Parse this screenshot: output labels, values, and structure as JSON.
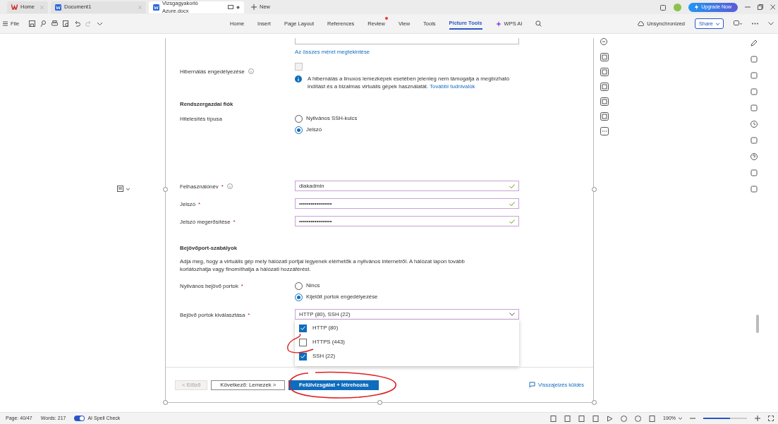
{
  "tabs": [
    {
      "label": "Home",
      "kind": "home",
      "selected": false
    },
    {
      "label": "Document1",
      "kind": "doc",
      "selected": false
    },
    {
      "label": "Vizsgagyakorló Azure.docx",
      "kind": "doc",
      "selected": true
    }
  ],
  "new_tab": "New",
  "upgrade": "Upgrade Now",
  "file_menu": "File",
  "ribbon": [
    {
      "label": "Home",
      "selected": false
    },
    {
      "label": "Insert",
      "selected": false
    },
    {
      "label": "Page Layout",
      "selected": false
    },
    {
      "label": "References",
      "selected": false
    },
    {
      "label": "Review",
      "selected": false,
      "dot": true
    },
    {
      "label": "View",
      "selected": false
    },
    {
      "label": "Tools",
      "selected": false
    },
    {
      "label": "Picture Tools",
      "selected": true
    },
    {
      "label": "WPS AI",
      "selected": false,
      "kind": "ai"
    }
  ],
  "sync": "Unsynchronized",
  "share": "Share",
  "form": {
    "size_link": "Az összes méret megtekintése",
    "hibernation": {
      "label": "Hibernálás engedélyezése",
      "checked": false,
      "info": "A hibernálás a linuxos lemezképek esetében jelenleg nem támogatja a megbízható indítást és a bizalmas virtuális gépek használatát.",
      "info_link": "További tudnivalók"
    },
    "admin_heading": "Rendszergazdai fiók",
    "auth": {
      "label": "Hitelesítés típusa",
      "options": [
        {
          "label": "Nyilvános SSH-kulcs",
          "selected": false
        },
        {
          "label": "Jelszó",
          "selected": true
        }
      ]
    },
    "fields": [
      {
        "label": "Felhasználónév",
        "mark": "*",
        "info": true,
        "value": "diakadmin",
        "valid": true
      },
      {
        "label": "Jelszó",
        "mark": "*",
        "info": false,
        "value": "•••••••••••••••••",
        "valid": true
      },
      {
        "label": "Jelszó megerősítése",
        "mark": "*",
        "info": false,
        "value": "•••••••••••••••••",
        "valid": true
      }
    ],
    "ports_heading": "Bejövőport-szabályok",
    "ports_desc": "Adja meg, hogy a virtuális gép mely hálózati portjai legyenek elérhetők a nyilvános internetről. A hálózat lapon tovább korlátozhatja vagy finomíthatja a hálózati hozzáférést.",
    "public_ports": {
      "label": "Nyilvános bejövő portok",
      "mark": "*",
      "options": [
        {
          "label": "Nincs",
          "selected": false
        },
        {
          "label": "Kijelölt portok engedélyezése",
          "selected": true
        }
      ]
    },
    "port_select": {
      "label": "Bejövő portok kiválasztása",
      "mark": "*",
      "value": "HTTP (80), SSH (22)",
      "expanded": true,
      "options": [
        {
          "label": "HTTP (80)",
          "checked": true
        },
        {
          "label": "HTTPS (443)",
          "checked": false
        },
        {
          "label": "SSH (22)",
          "checked": true
        }
      ]
    },
    "buttons": [
      {
        "label": "< Előző",
        "kind": "disabled"
      },
      {
        "label": "Következő: Lemezek >",
        "kind": "secondary"
      },
      {
        "label": "Felülvizsgálat + létrehozás",
        "kind": "primary"
      }
    ],
    "feedback": "Visszajelzés küldés"
  },
  "status_bar": {
    "page": "Page: 40/47",
    "words": "Words: 217",
    "spell": {
      "label": "AI Spell Check",
      "on": true
    },
    "zoom": "190%",
    "zoom_slider": {
      "level": 0.62
    }
  }
}
